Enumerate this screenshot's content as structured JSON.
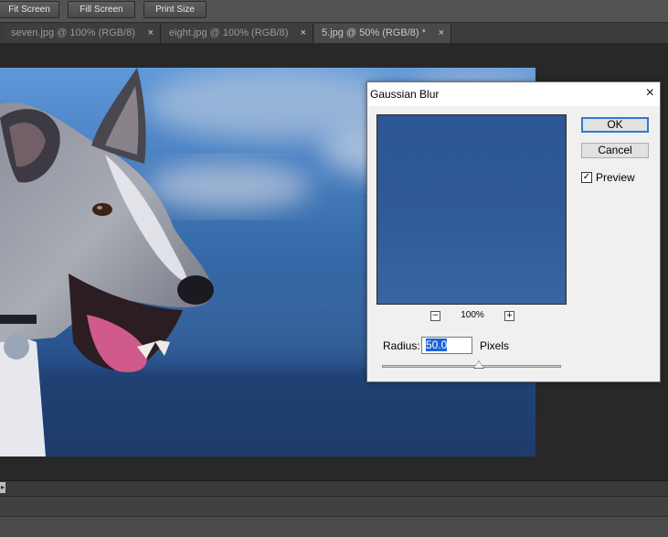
{
  "options_bar": {
    "buttons": [
      "Fit Screen",
      "Fill Screen",
      "Print Size"
    ]
  },
  "tabs": [
    {
      "label": "seven.jpg @ 100% (RGB/8)",
      "close": "×"
    },
    {
      "label": "eight.jpg @ 100% (RGB/8)",
      "close": "×"
    },
    {
      "label": "5.jpg @ 50% (RGB/8) *",
      "close": "×"
    }
  ],
  "dialog": {
    "title": "Gaussian Blur",
    "close_icon": "×",
    "ok_label": "OK",
    "cancel_label": "Cancel",
    "preview_label": "Preview",
    "preview_checked": true,
    "zoom_out": "−",
    "zoom_in": "+",
    "zoom_level": "100%",
    "radius_label": "Radius:",
    "radius_value": "50.0",
    "radius_unit": "Pixels",
    "radius_slider_level": 0.54
  },
  "colors": {
    "accent": "#2f7ad0",
    "selection": "#1e63d1",
    "preview_fill": "#30599a"
  }
}
